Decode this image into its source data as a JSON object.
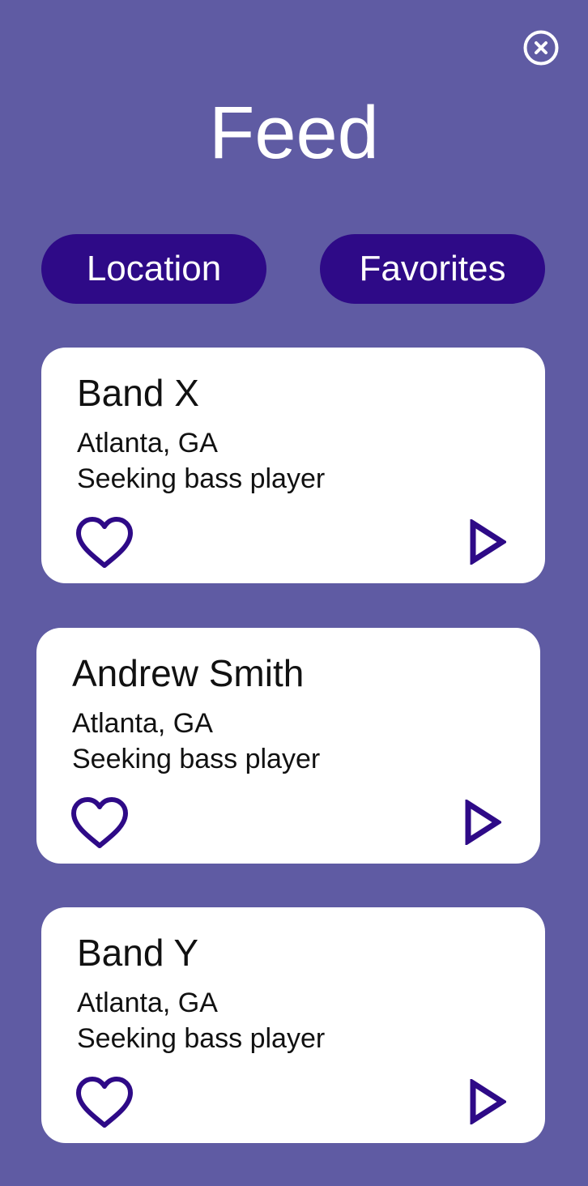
{
  "header": {
    "title": "Feed",
    "close_icon": "close-circle-icon"
  },
  "filters": [
    {
      "label": "Location"
    },
    {
      "label": "Favorites"
    }
  ],
  "feed": [
    {
      "name": "Band X",
      "location": "Atlanta, GA",
      "status": "Seeking bass player",
      "favorite_icon": "heart-outline-icon",
      "action_icon": "play-icon"
    },
    {
      "name": "Andrew Smith",
      "location": "Atlanta, GA",
      "status": "Seeking bass player",
      "favorite_icon": "heart-outline-icon",
      "action_icon": "play-icon"
    },
    {
      "name": "Band Y",
      "location": "Atlanta, GA",
      "status": "Seeking bass player",
      "favorite_icon": "heart-outline-icon",
      "action_icon": "play-icon"
    }
  ],
  "colors": {
    "background": "#5f5ba3",
    "accent": "#2e0a87",
    "card": "#ffffff",
    "text": "#111111"
  }
}
